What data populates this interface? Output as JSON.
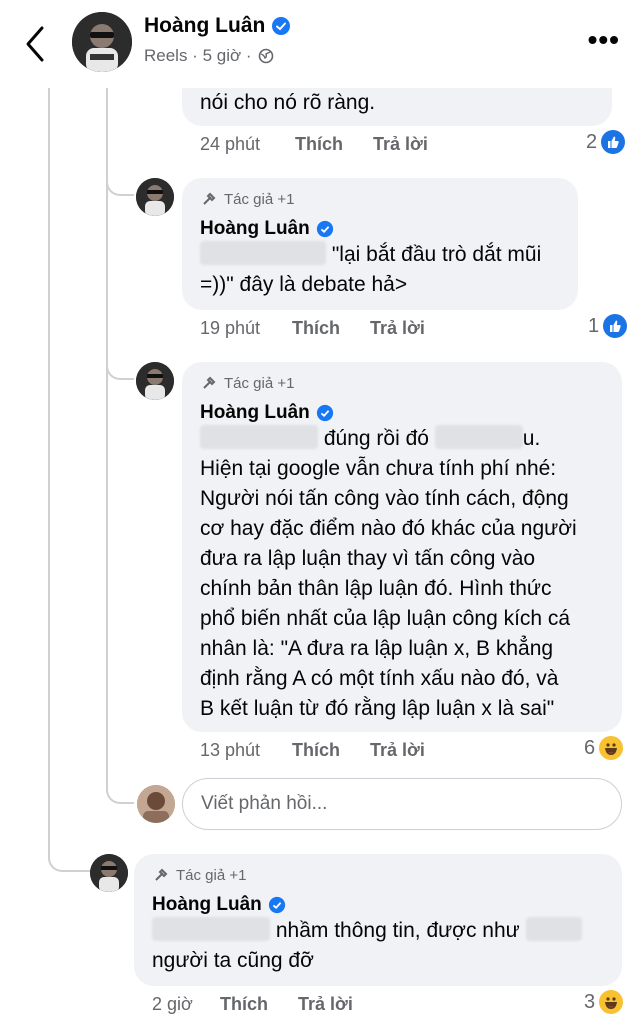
{
  "header": {
    "name": "Hoàng Luân",
    "sub": "Reels · 5 giờ ·",
    "back_icon": "chevron-left-icon",
    "more_icon": "more-icon",
    "verified_color": "#1877f2"
  },
  "comments": [
    {
      "text_tail": "nói cho nó rõ ràng.",
      "time": "24 phút",
      "like": "Thích",
      "reply": "Trả lời",
      "reaction_count": "2",
      "reaction": "like"
    },
    {
      "author_tag": "Tác giả +1",
      "name": "Hoàng Luân",
      "line1": "\"lại bắt đầu trò dắt mũi",
      "line2": "=))\" đây là debate hả>",
      "time": "19 phút",
      "like": "Thích",
      "reply": "Trả lời",
      "reaction_count": "1",
      "reaction": "like"
    },
    {
      "author_tag": "Tác giả +1",
      "name": "Hoàng Luân",
      "line1a": "đúng rồi đó",
      "line1b": "u.",
      "lines": [
        "Hiện tại google vẫn chưa tính phí nhé:",
        "Người nói tấn công vào tính cách, động",
        "cơ hay đặc điểm nào đó khác của người",
        "đưa ra lập luận thay vì tấn công vào",
        "chính bản thân lập luận đó. Hình thức",
        "phổ biến nhất của lập luận công kích cá",
        "nhân là: \"A đưa ra lập luận x, B khẳng",
        "định rằng A có một tính xấu nào đó, và",
        "B kết luận từ đó rằng lập luận x là sai\""
      ],
      "time": "13 phút",
      "like": "Thích",
      "reply": "Trả lời",
      "reaction_count": "6",
      "reaction": "haha"
    },
    {
      "author_tag": "Tác giả +1",
      "name": "Hoàng Luân",
      "line1": "nhầm thông tin, được như",
      "line2": "người ta cũng đỡ",
      "time": "2 giờ",
      "like": "Thích",
      "reply": "Trả lời",
      "reaction_count": "3",
      "reaction": "haha"
    }
  ],
  "reply_input": {
    "placeholder": "Viết phản hồi..."
  }
}
